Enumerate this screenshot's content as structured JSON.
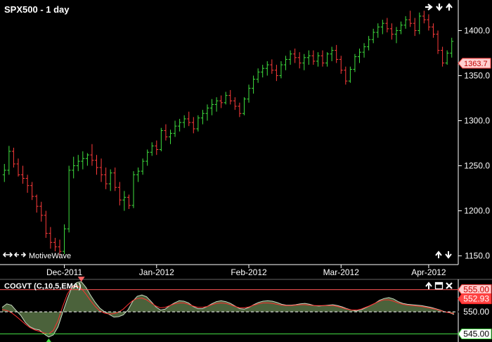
{
  "chart_data": [
    {
      "type": "ohlc",
      "title": "SPX500 - 1 day",
      "ylim": [
        1145,
        1430
      ],
      "y_ticks": [
        1150,
        1200,
        1250,
        1300,
        1350,
        1400
      ],
      "y_tick_labels": [
        "1150.0",
        "1200.0",
        "1250.0",
        "1300.0",
        "1350.0",
        "1400.0"
      ],
      "x_tick_labels": [
        {
          "label": "Dec-2011",
          "index": 13
        },
        {
          "label": "Jan-2012",
          "index": 33
        },
        {
          "label": "Feb-2012",
          "index": 53
        },
        {
          "label": "Mar-2012",
          "index": 73
        },
        {
          "label": "Apr-2012",
          "index": 92
        }
      ],
      "last_price": 1363.7,
      "last_price_label": "1363.7",
      "colors": {
        "up": "#3fe03f",
        "down": "#ff3b3b",
        "background": "#000000",
        "axis": "#ffffff"
      },
      "series": [
        {
          "values": [
            [
              1240,
              1252,
              1232,
              1245
            ],
            [
              1245,
              1272,
              1240,
              1266
            ],
            [
              1266,
              1270,
              1248,
              1252
            ],
            [
              1252,
              1258,
              1238,
              1240
            ],
            [
              1240,
              1250,
              1230,
              1236
            ],
            [
              1236,
              1240,
              1220,
              1228
            ],
            [
              1228,
              1232,
              1212,
              1216
            ],
            [
              1216,
              1218,
              1198,
              1205
            ],
            [
              1205,
              1210,
              1188,
              1195
            ],
            [
              1195,
              1200,
              1170,
              1175
            ],
            [
              1175,
              1182,
              1158,
              1165
            ],
            [
              1165,
              1170,
              1155,
              1160
            ],
            [
              1160,
              1168,
              1150,
              1155
            ],
            [
              1155,
              1185,
              1152,
              1180
            ],
            [
              1180,
              1250,
              1176,
              1245
            ],
            [
              1245,
              1260,
              1236,
              1250
            ],
            [
              1250,
              1262,
              1244,
              1255
            ],
            [
              1255,
              1266,
              1246,
              1258
            ],
            [
              1258,
              1264,
              1250,
              1262
            ],
            [
              1262,
              1274,
              1250,
              1256
            ],
            [
              1256,
              1262,
              1240,
              1248
            ],
            [
              1248,
              1258,
              1232,
              1240
            ],
            [
              1240,
              1248,
              1224,
              1230
            ],
            [
              1230,
              1246,
              1222,
              1242
            ],
            [
              1242,
              1248,
              1222,
              1226
            ],
            [
              1226,
              1232,
              1206,
              1212
            ],
            [
              1212,
              1222,
              1200,
              1215
            ],
            [
              1215,
              1218,
              1202,
              1206
            ],
            [
              1206,
              1244,
              1203,
              1240
            ],
            [
              1240,
              1248,
              1232,
              1244
            ],
            [
              1244,
              1258,
              1240,
              1255
            ],
            [
              1255,
              1268,
              1250,
              1265
            ],
            [
              1265,
              1276,
              1261,
              1272
            ],
            [
              1272,
              1278,
              1262,
              1268
            ],
            [
              1268,
              1292,
              1266,
              1289
            ],
            [
              1289,
              1296,
              1278,
              1282
            ],
            [
              1282,
              1290,
              1274,
              1286
            ],
            [
              1286,
              1300,
              1282,
              1294
            ],
            [
              1294,
              1302,
              1288,
              1298
            ],
            [
              1298,
              1306,
              1292,
              1302
            ],
            [
              1302,
              1310,
              1294,
              1298
            ],
            [
              1298,
              1304,
              1286,
              1291
            ],
            [
              1291,
              1306,
              1288,
              1303
            ],
            [
              1303,
              1312,
              1296,
              1308
            ],
            [
              1308,
              1318,
              1300,
              1314
            ],
            [
              1314,
              1324,
              1306,
              1318
            ],
            [
              1318,
              1326,
              1310,
              1322
            ],
            [
              1322,
              1328,
              1314,
              1320
            ],
            [
              1320,
              1332,
              1318,
              1328
            ],
            [
              1328,
              1334,
              1318,
              1322
            ],
            [
              1322,
              1326,
              1312,
              1316
            ],
            [
              1316,
              1320,
              1304,
              1308
            ],
            [
              1308,
              1326,
              1306,
              1324
            ],
            [
              1324,
              1340,
              1320,
              1336
            ],
            [
              1336,
              1350,
              1330,
              1346
            ],
            [
              1346,
              1358,
              1342,
              1354
            ],
            [
              1354,
              1362,
              1348,
              1358
            ],
            [
              1358,
              1366,
              1350,
              1362
            ],
            [
              1362,
              1368,
              1352,
              1356
            ],
            [
              1356,
              1362,
              1344,
              1350
            ],
            [
              1350,
              1366,
              1347,
              1362
            ],
            [
              1362,
              1372,
              1356,
              1368
            ],
            [
              1368,
              1378,
              1362,
              1374
            ],
            [
              1374,
              1380,
              1364,
              1370
            ],
            [
              1370,
              1376,
              1358,
              1364
            ],
            [
              1364,
              1374,
              1356,
              1370
            ],
            [
              1370,
              1378,
              1362,
              1372
            ],
            [
              1372,
              1378,
              1362,
              1366
            ],
            [
              1366,
              1376,
              1360,
              1372
            ],
            [
              1372,
              1378,
              1360,
              1364
            ],
            [
              1364,
              1376,
              1360,
              1374
            ],
            [
              1374,
              1382,
              1366,
              1378
            ],
            [
              1378,
              1384,
              1364,
              1368
            ],
            [
              1368,
              1372,
              1352,
              1356
            ],
            [
              1356,
              1360,
              1340,
              1344
            ],
            [
              1344,
              1360,
              1342,
              1357
            ],
            [
              1357,
              1374,
              1354,
              1371
            ],
            [
              1371,
              1380,
              1364,
              1376
            ],
            [
              1376,
              1386,
              1370,
              1382
            ],
            [
              1382,
              1394,
              1378,
              1390
            ],
            [
              1390,
              1402,
              1386,
              1398
            ],
            [
              1398,
              1408,
              1392,
              1404
            ],
            [
              1404,
              1412,
              1396,
              1408
            ],
            [
              1408,
              1414,
              1398,
              1402
            ],
            [
              1402,
              1408,
              1390,
              1396
            ],
            [
              1396,
              1404,
              1386,
              1400
            ],
            [
              1400,
              1410,
              1396,
              1406
            ],
            [
              1406,
              1416,
              1402,
              1412
            ],
            [
              1412,
              1422,
              1404,
              1408
            ],
            [
              1408,
              1414,
              1394,
              1400
            ],
            [
              1400,
              1420,
              1396,
              1416
            ],
            [
              1416,
              1422,
              1408,
              1412
            ],
            [
              1412,
              1418,
              1400,
              1404
            ],
            [
              1404,
              1408,
              1392,
              1396
            ],
            [
              1396,
              1400,
              1374,
              1378
            ],
            [
              1378,
              1382,
              1360,
              1364
            ],
            [
              1364,
              1378,
              1362,
              1375
            ],
            [
              1375,
              1392,
              1370,
              1388
            ]
          ]
        }
      ]
    },
    {
      "type": "oscillator",
      "title": "COGVT (C,10,5,EMA)",
      "ylim": [
        543.5,
        557.0
      ],
      "y_labels": [
        "555.00",
        "552.93",
        "550.00",
        "545.00"
      ],
      "levels": [
        555.0,
        550.0,
        545.0
      ],
      "current_value": 552.93,
      "colors": {
        "fill": "#5e7a4a",
        "fill_opacity": "0.8",
        "signal": "#ff3030",
        "level": "#ff5555",
        "mid": "#ffffff",
        "low": "#44dd44"
      },
      "series": [
        {
          "values": [
            551.0,
            551.8,
            551.5,
            550.3,
            549.2,
            547.6,
            546.6,
            546.1,
            545.9,
            545.0,
            544.3,
            544.8,
            546.6,
            549.8,
            552.9,
            555.6,
            556.6,
            556.8,
            555.5,
            553.7,
            552.1,
            550.8,
            550.0,
            549.4,
            548.8,
            548.9,
            549.3,
            550.4,
            552.3,
            553.5,
            553.8,
            553.4,
            552.3,
            551.1,
            550.4,
            550.6,
            551.4,
            552.0,
            552.5,
            552.4,
            552.0,
            551.2,
            550.7,
            550.7,
            551.2,
            551.8,
            552.3,
            552.5,
            552.3,
            551.9,
            551.3,
            550.7,
            550.6,
            551.0,
            551.6,
            552.1,
            552.4,
            552.5,
            552.4,
            552.1,
            551.7,
            551.5,
            551.5,
            551.6,
            551.8,
            551.9,
            551.7,
            551.4,
            551.3,
            551.4,
            551.5,
            551.6,
            551.4,
            551.1,
            550.7,
            550.4,
            550.2,
            550.4,
            550.9,
            551.4,
            551.9,
            552.6,
            553.0,
            553.2,
            552.9,
            552.3,
            551.9,
            551.7,
            551.6,
            551.5,
            551.4,
            551.2,
            551.0,
            550.7,
            550.4,
            550.0,
            549.8,
            549.4
          ]
        },
        {
          "values": [
            550.5,
            550.3,
            549.8,
            549.0,
            548.1,
            547.2,
            546.4,
            545.9,
            545.6,
            545.2,
            545.0,
            545.8,
            548.0,
            551.2,
            554.0,
            555.6,
            555.9,
            555.3,
            554.0,
            552.5,
            551.2,
            550.2,
            549.7,
            549.5,
            549.6,
            549.9,
            550.6,
            551.6,
            552.5,
            553.0,
            553.1,
            552.7,
            552.0,
            551.3,
            550.9,
            551.0,
            551.4,
            551.8,
            552.0,
            552.0,
            551.7,
            551.3,
            551.0,
            551.0,
            551.2,
            551.6,
            551.9,
            552.0,
            551.9,
            551.6,
            551.2,
            550.9,
            550.9,
            551.1,
            551.5,
            551.8,
            552.0,
            552.0,
            551.9,
            551.7,
            551.5,
            551.4,
            551.4,
            551.5,
            551.6,
            551.6,
            551.5,
            551.4,
            551.4,
            551.4,
            551.4,
            551.4,
            551.2,
            550.9,
            550.6,
            550.4,
            550.4,
            550.6,
            551.0,
            551.4,
            551.9,
            552.4,
            552.7,
            552.7,
            552.4,
            552.0,
            551.7,
            551.5,
            551.4,
            551.3,
            551.2,
            551.0,
            550.8,
            550.6,
            550.3,
            550.0,
            549.8,
            549.6
          ]
        }
      ]
    }
  ],
  "watermark": "MotiveWave",
  "icons": {
    "nav": "pan-arrows-icon",
    "up": "arrow-up-icon",
    "down": "arrow-down-icon"
  }
}
